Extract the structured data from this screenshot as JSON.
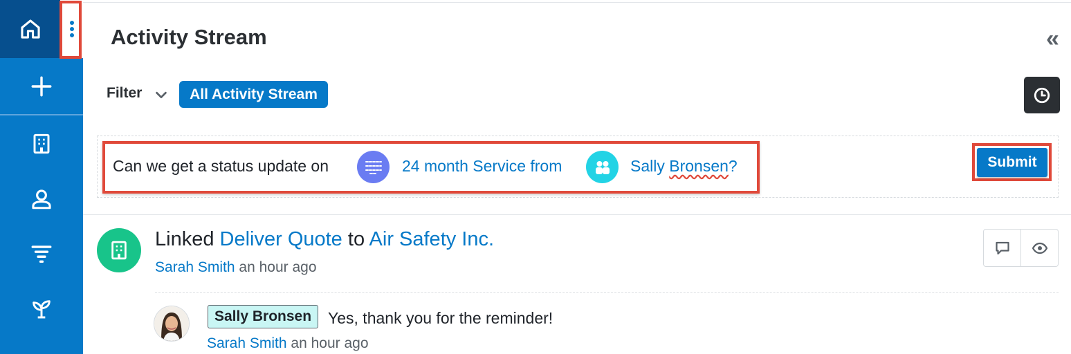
{
  "sidebar": {
    "items": [
      {
        "icon": "home-icon"
      },
      {
        "icon": "plus-icon"
      },
      {
        "icon": "building-icon"
      },
      {
        "icon": "person-icon"
      },
      {
        "icon": "filter-funnel-icon"
      },
      {
        "icon": "sprout-icon"
      }
    ],
    "menu_icon": "kebab-menu-icon"
  },
  "header": {
    "title": "Activity Stream",
    "collapse_glyph": "«"
  },
  "filter": {
    "label": "Filter",
    "selected": "All Activity Stream"
  },
  "compose": {
    "text_before": "Can we get a status update on ",
    "mention_1": "24 month Service from",
    "mention_2_first": "Sally ",
    "mention_2_second": "Bronsen",
    "mention_2_tail": "?",
    "submit_label": "Submit"
  },
  "activity": {
    "verb": "Linked ",
    "object": "Deliver Quote",
    "connector": " to ",
    "target": "Air Safety Inc.",
    "author": "Sarah Smith",
    "time": " an hour ago",
    "reply": {
      "tag": "Sally Bronsen",
      "text": "Yes, thank you for the reminder!",
      "author": "Sarah Smith",
      "time": " an hour ago"
    }
  },
  "colors": {
    "sidebar": "#0679c8",
    "sidebar_active": "#064f8e",
    "accent": "#0679c8",
    "highlight_box": "#e0493a",
    "account_icon": "#18c48a",
    "quote_icon": "#6a7cf2",
    "contact_icon": "#22d3e5",
    "tag_bg": "#c9f6f4"
  }
}
